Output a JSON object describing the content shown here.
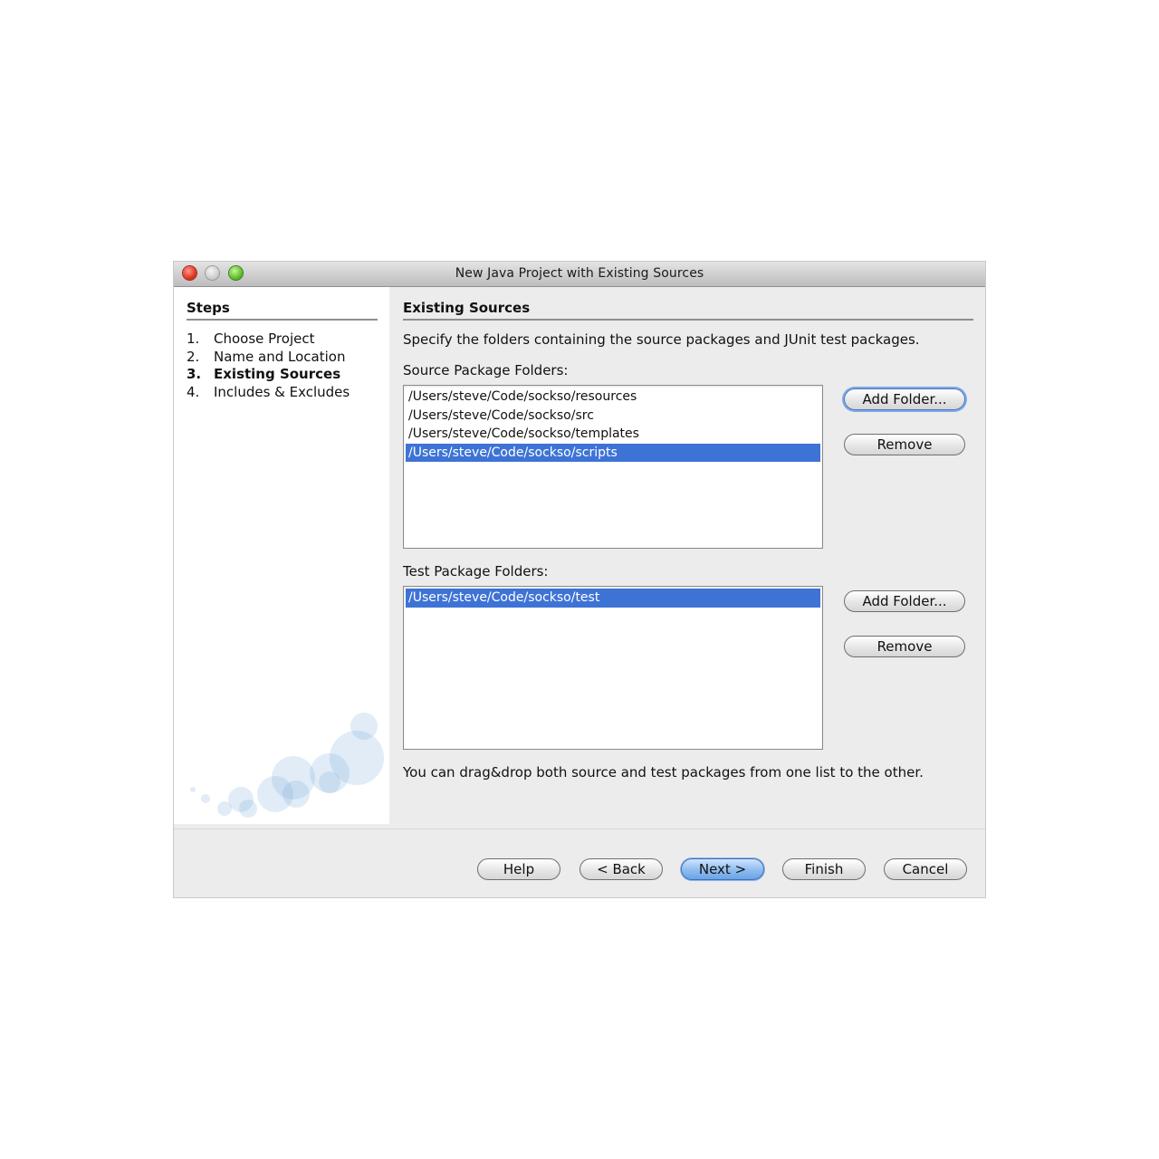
{
  "window": {
    "title": "New Java Project with Existing Sources"
  },
  "steps": {
    "title": "Steps",
    "current_index": 2,
    "items": [
      {
        "num": "1.",
        "label": "Choose Project"
      },
      {
        "num": "2.",
        "label": "Name and Location"
      },
      {
        "num": "3.",
        "label": "Existing Sources"
      },
      {
        "num": "4.",
        "label": "Includes & Excludes"
      }
    ]
  },
  "content": {
    "title": "Existing Sources",
    "description": "Specify the folders containing the source packages and JUnit test packages.",
    "source": {
      "label": "Source Package Folders:",
      "items": [
        "/Users/steve/Code/sockso/resources",
        "/Users/steve/Code/sockso/src",
        "/Users/steve/Code/sockso/templates",
        "/Users/steve/Code/sockso/scripts"
      ],
      "selected_index": 3,
      "add_label": "Add Folder...",
      "remove_label": "Remove"
    },
    "test": {
      "label": "Test Package Folders:",
      "items": [
        "/Users/steve/Code/sockso/test"
      ],
      "selected_index": 0,
      "add_label": "Add Folder...",
      "remove_label": "Remove"
    },
    "hint": "You can drag&drop both source and test packages from one list to the other."
  },
  "footer": {
    "help": "Help",
    "back": "< Back",
    "next": "Next >",
    "finish": "Finish",
    "cancel": "Cancel"
  },
  "colors": {
    "selection": "#3e73d6",
    "primary_button": "#8ebcf0"
  }
}
